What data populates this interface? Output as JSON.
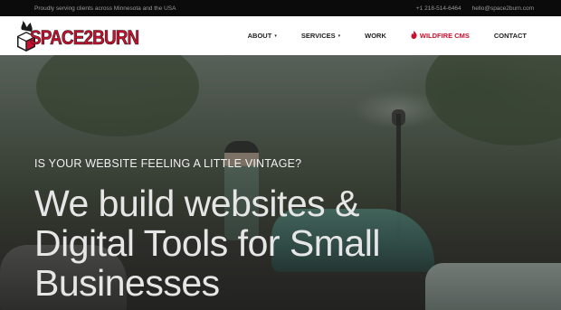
{
  "topbar": {
    "tagline": "Proudly serving clients across Minnesota and the USA",
    "phone": "+1 218-514-6464",
    "email": "hello@space2burn.com"
  },
  "brand": {
    "logo_text": "SPACE2BURN",
    "accent_color": "#c8102e"
  },
  "nav": {
    "items": [
      {
        "label": "ABOUT",
        "dropdown": true
      },
      {
        "label": "SERVICES",
        "dropdown": true
      },
      {
        "label": "WORK",
        "dropdown": false
      },
      {
        "label": "WILDFIRE CMS",
        "dropdown": false,
        "icon": "flame-icon"
      },
      {
        "label": "CONTACT",
        "dropdown": false
      }
    ],
    "caret": "▾",
    "flame": "🔥"
  },
  "hero": {
    "eyebrow": "IS YOUR WEBSITE FEELING A LITTLE VINTAGE?",
    "headline_lines": [
      "We build websites &",
      "Digital Tools for Small",
      "Businesses"
    ]
  }
}
